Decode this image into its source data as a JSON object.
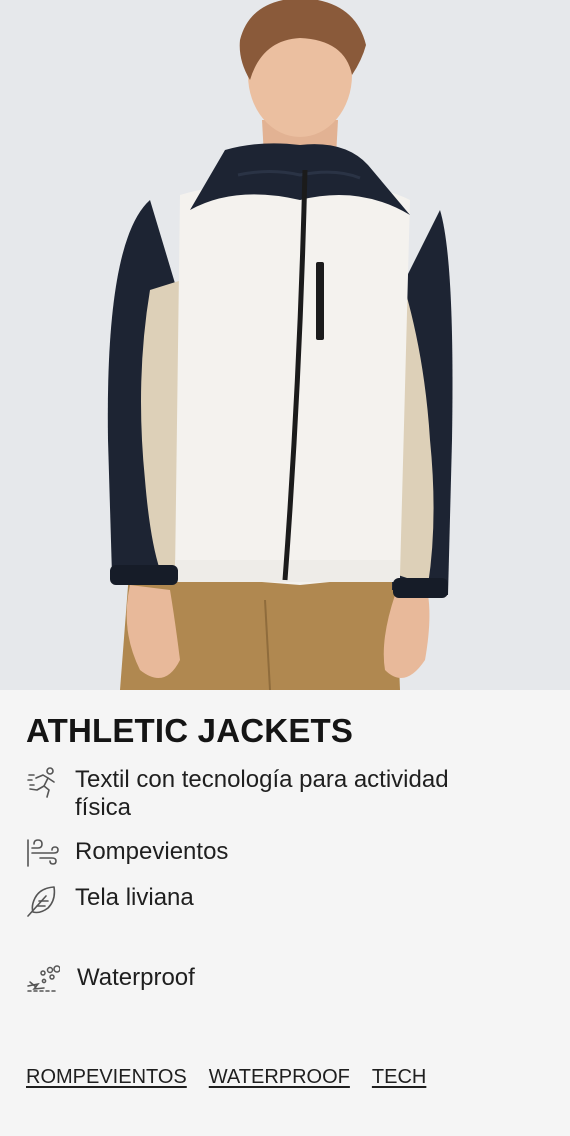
{
  "product": {
    "image_alt": "Model wearing a white, navy and beige windbreaker jacket",
    "title": "ATHLETIC JACKETS"
  },
  "features": [
    {
      "icon": "runner-icon",
      "text": "Textil con tecnología para actividad física"
    },
    {
      "icon": "wind-icon",
      "text": "Rompevientos"
    },
    {
      "icon": "feather-icon",
      "text": "Tela liviana"
    },
    {
      "icon": "rain-drops-icon",
      "text": "Waterproof"
    }
  ],
  "tags": [
    "ROMPEVIENTOS",
    "WATERPROOF",
    "TECH"
  ],
  "colors": {
    "hero_bg": "#e6e8eb",
    "panel_bg": "#f5f5f5",
    "jacket_navy": "#1d2433",
    "jacket_white": "#f4f2ee",
    "jacket_beige": "#ddd0b8",
    "pants_khaki": "#b08850"
  }
}
